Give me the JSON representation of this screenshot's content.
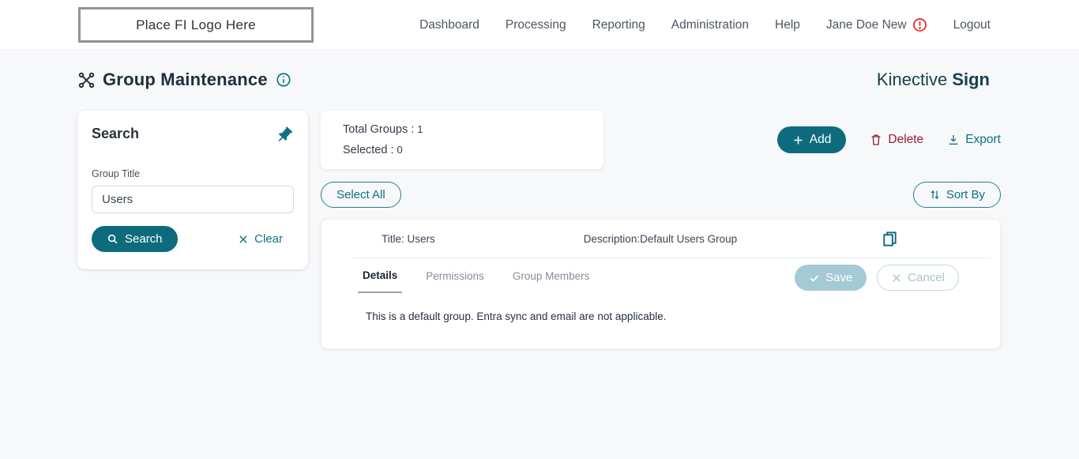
{
  "header": {
    "logo_text": "Place FI Logo Here",
    "nav": [
      {
        "label": "Dashboard"
      },
      {
        "label": "Processing"
      },
      {
        "label": "Reporting"
      },
      {
        "label": "Administration"
      },
      {
        "label": "Help"
      },
      {
        "label": "Jane Doe New",
        "has_warning_badge": true
      },
      {
        "label": "Logout"
      }
    ]
  },
  "page": {
    "title": "Group Maintenance",
    "brand_name": "Kinective",
    "brand_product": "Sign"
  },
  "search_panel": {
    "title": "Search",
    "group_title_label": "Group Title",
    "group_title_value": "Users",
    "search_button": "Search",
    "clear_button": "Clear"
  },
  "summary": {
    "total_groups_label": "Total Groups :",
    "total_groups_value": "1",
    "selected_label": "Selected :",
    "selected_value": "0"
  },
  "toolbar": {
    "add_label": "Add",
    "delete_label": "Delete",
    "export_label": "Export",
    "select_all_label": "Select All",
    "sort_by_label": "Sort By"
  },
  "group": {
    "title_label": "Title:",
    "title_value": "Users",
    "description_label": "Description:",
    "description_value": "Default Users Group",
    "tabs": [
      {
        "label": "Details",
        "active": true
      },
      {
        "label": "Permissions",
        "active": false
      },
      {
        "label": "Group Members",
        "active": false
      }
    ],
    "save_label": "Save",
    "cancel_label": "Cancel",
    "details_text": "This is a default group. Entra sync and email are not applicable."
  },
  "colors": {
    "accent_teal": "#0e6b7d",
    "link_teal": "#0f7187",
    "brand_dark_teal": "#17414f",
    "delete_red": "#9e1b33",
    "warning_red": "#e02424",
    "disabled_blue_gray": "#a5cad5"
  }
}
